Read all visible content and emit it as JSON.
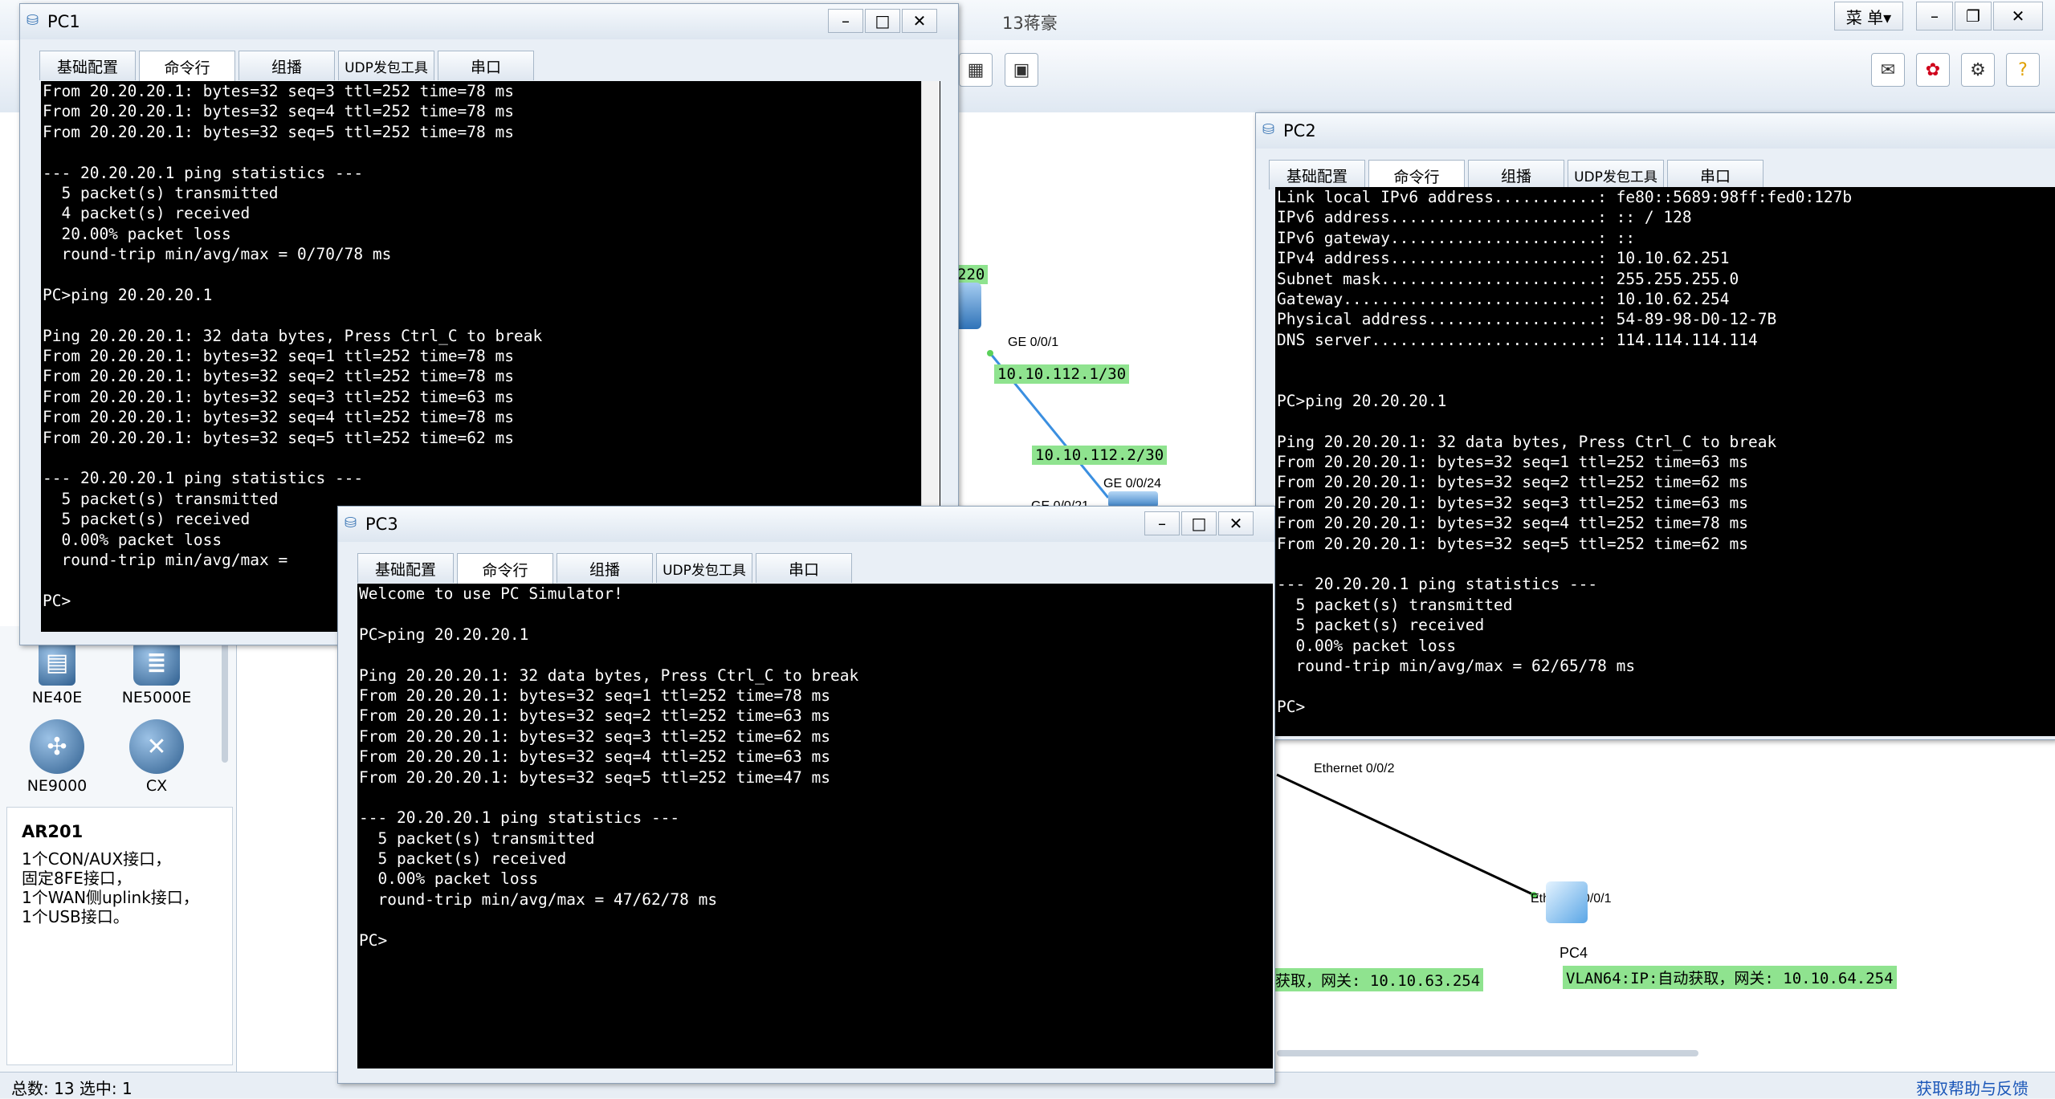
{
  "app": {
    "title": "13蒋豪",
    "menu_label": "菜 单▾",
    "win_min": "–",
    "win_restore": "❐",
    "win_close": "✕"
  },
  "statusbar": {
    "left": "总数: 13  选中: 1",
    "right": "获取帮助与反馈"
  },
  "devices": [
    {
      "name": "NE40E"
    },
    {
      "name": "NE5000E"
    },
    {
      "name": "NE9000"
    },
    {
      "name": "CX"
    }
  ],
  "device_desc": {
    "title": "AR201",
    "lines": [
      "1个CON/AUX接口，",
      "固定8FE接口，",
      "1个WAN侧uplink接口，",
      "1个USB接口。"
    ]
  },
  "topology": {
    "label_220": "220",
    "port_ge001": "GE 0/0/1",
    "ip_a": "10.10.112.1/30",
    "ip_b": "10.10.112.2/30",
    "port_ge0024": "GE 0/0/24",
    "port_ge0021": "GE 0/0/21",
    "port_eth002": "Ethernet 0/0/2",
    "port_eth001": "Ethernet 0/0/1",
    "pc4_label": "PC4",
    "vlan63": "获取，网关: 10.10.63.254",
    "vlan64": "VLAN64:IP:自动获取，网关: 10.10.64.254"
  },
  "tabs": [
    "基础配置",
    "命令行",
    "组播",
    "UDP发包工具",
    "串口"
  ],
  "pc1": {
    "title": "PC1",
    "lines": [
      "From 20.20.20.1: bytes=32 seq=3 ttl=252 time=78 ms",
      "From 20.20.20.1: bytes=32 seq=4 ttl=252 time=78 ms",
      "From 20.20.20.1: bytes=32 seq=5 ttl=252 time=78 ms",
      "",
      "--- 20.20.20.1 ping statistics ---",
      "  5 packet(s) transmitted",
      "  4 packet(s) received",
      "  20.00% packet loss",
      "  round-trip min/avg/max = 0/70/78 ms",
      "",
      "PC>ping 20.20.20.1",
      "",
      "Ping 20.20.20.1: 32 data bytes, Press Ctrl_C to break",
      "From 20.20.20.1: bytes=32 seq=1 ttl=252 time=78 ms",
      "From 20.20.20.1: bytes=32 seq=2 ttl=252 time=78 ms",
      "From 20.20.20.1: bytes=32 seq=3 ttl=252 time=63 ms",
      "From 20.20.20.1: bytes=32 seq=4 ttl=252 time=78 ms",
      "From 20.20.20.1: bytes=32 seq=5 ttl=252 time=62 ms",
      "",
      "--- 20.20.20.1 ping statistics ---",
      "  5 packet(s) transmitted",
      "  5 packet(s) received",
      "  0.00% packet loss",
      "  round-trip min/avg/max = ",
      "",
      "PC>"
    ]
  },
  "pc2": {
    "title": "PC2",
    "lines": [
      "Link local IPv6 address...........: fe80::5689:98ff:fed0:127b",
      "IPv6 address......................: :: / 128",
      "IPv6 gateway......................: ::",
      "IPv4 address......................: 10.10.62.251",
      "Subnet mask.......................: 255.255.255.0",
      "Gateway...........................: 10.10.62.254",
      "Physical address..................: 54-89-98-D0-12-7B",
      "DNS server........................: 114.114.114.114",
      "",
      "",
      "PC>ping 20.20.20.1",
      "",
      "Ping 20.20.20.1: 32 data bytes, Press Ctrl_C to break",
      "From 20.20.20.1: bytes=32 seq=1 ttl=252 time=63 ms",
      "From 20.20.20.1: bytes=32 seq=2 ttl=252 time=62 ms",
      "From 20.20.20.1: bytes=32 seq=3 ttl=252 time=63 ms",
      "From 20.20.20.1: bytes=32 seq=4 ttl=252 time=78 ms",
      "From 20.20.20.1: bytes=32 seq=5 ttl=252 time=62 ms",
      "",
      "--- 20.20.20.1 ping statistics ---",
      "  5 packet(s) transmitted",
      "  5 packet(s) received",
      "  0.00% packet loss",
      "  round-trip min/avg/max = 62/65/78 ms",
      "",
      "PC>"
    ]
  },
  "pc3": {
    "title": "PC3",
    "lines": [
      "Welcome to use PC Simulator!",
      "",
      "PC>ping 20.20.20.1",
      "",
      "Ping 20.20.20.1: 32 data bytes, Press Ctrl_C to break",
      "From 20.20.20.1: bytes=32 seq=1 ttl=252 time=78 ms",
      "From 20.20.20.1: bytes=32 seq=2 ttl=252 time=63 ms",
      "From 20.20.20.1: bytes=32 seq=3 ttl=252 time=62 ms",
      "From 20.20.20.1: bytes=32 seq=4 ttl=252 time=63 ms",
      "From 20.20.20.1: bytes=32 seq=5 ttl=252 time=47 ms",
      "",
      "--- 20.20.20.1 ping statistics ---",
      "  5 packet(s) transmitted",
      "  5 packet(s) received",
      "  0.00% packet loss",
      "  round-trip min/avg/max = 47/62/78 ms",
      "",
      "PC>"
    ]
  },
  "colors": {
    "link_blue": "#3b8fe0",
    "label_green": "#8fe38f"
  }
}
